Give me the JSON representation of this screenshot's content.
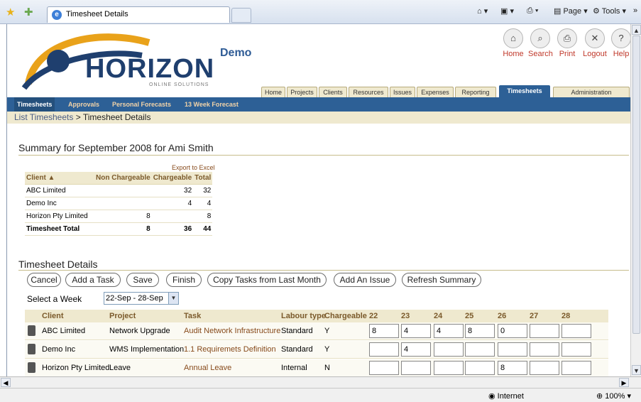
{
  "browser": {
    "tab_title": "Timesheet Details",
    "page_menu": "Page",
    "tools_menu": "Tools",
    "status_zone": "Internet",
    "zoom": "100%"
  },
  "app": {
    "logo_word": "HORIZON",
    "logo_sub": "ONLINE SOLUTIONS",
    "demo_label": "Demo",
    "top_icons": [
      {
        "label": "Home",
        "icon": "home-icon"
      },
      {
        "label": "Search",
        "icon": "search-icon"
      },
      {
        "label": "Print",
        "icon": "print-icon"
      },
      {
        "label": "Logout",
        "icon": "close-icon"
      },
      {
        "label": "Help",
        "icon": "help-icon"
      }
    ],
    "tabs": [
      "Home",
      "Projects",
      "Clients",
      "Resources",
      "Issues",
      "Expenses",
      "Reporting",
      "Timesheets",
      "Administration"
    ],
    "active_tab": "Timesheets",
    "subtabs": [
      "Timesheets",
      "Approvals",
      "Personal Forecasts",
      "13 Week Forecast"
    ],
    "breadcrumb": {
      "link": "List Timesheets",
      "sep": ">",
      "current": "Timesheet Details"
    }
  },
  "summary": {
    "heading": "Summary for September 2008 for Ami Smith",
    "export_label": "Export to Excel",
    "headers": [
      "Client ▲",
      "Non Chargeable",
      "Chargeable",
      "Total"
    ],
    "rows": [
      [
        "ABC Limited",
        "",
        "32",
        "32"
      ],
      [
        "Demo Inc",
        "",
        "4",
        "4"
      ],
      [
        "Horizon Pty Limited",
        "8",
        "",
        "8"
      ]
    ],
    "total_row": [
      "Timesheet Total",
      "8",
      "36",
      "44"
    ]
  },
  "details": {
    "heading": "Timesheet Details",
    "buttons": [
      "Cancel",
      "Add a Task",
      "Save",
      "Finish",
      "Copy Tasks from Last Month",
      "Add An Issue",
      "Refresh Summary"
    ],
    "week_label": "Select a Week",
    "week_value": "22-Sep - 28-Sep",
    "headers": [
      "Client",
      "Project",
      "Task",
      "Labour type",
      "Chargeable",
      "22",
      "23",
      "24",
      "25",
      "26",
      "27",
      "28"
    ],
    "rows": [
      {
        "client": "ABC Limited",
        "project": "Network Upgrade",
        "task": "Audit Network Infrastructure",
        "labour": "Standard",
        "chargeable": "Y",
        "hours": [
          "8",
          "4",
          "4",
          "8",
          "0",
          "",
          ""
        ]
      },
      {
        "client": "Demo Inc",
        "project": "WMS Implementation",
        "task": "1.1 Requiremets Definition",
        "labour": "Standard",
        "chargeable": "Y",
        "hours": [
          "",
          "4",
          "",
          "",
          "",
          "",
          ""
        ]
      },
      {
        "client": "Horizon Pty Limited",
        "project": "Leave",
        "task": "Annual Leave",
        "labour": "Internal",
        "chargeable": "N",
        "hours": [
          "",
          "",
          "",
          "",
          "8",
          "",
          ""
        ]
      }
    ]
  }
}
